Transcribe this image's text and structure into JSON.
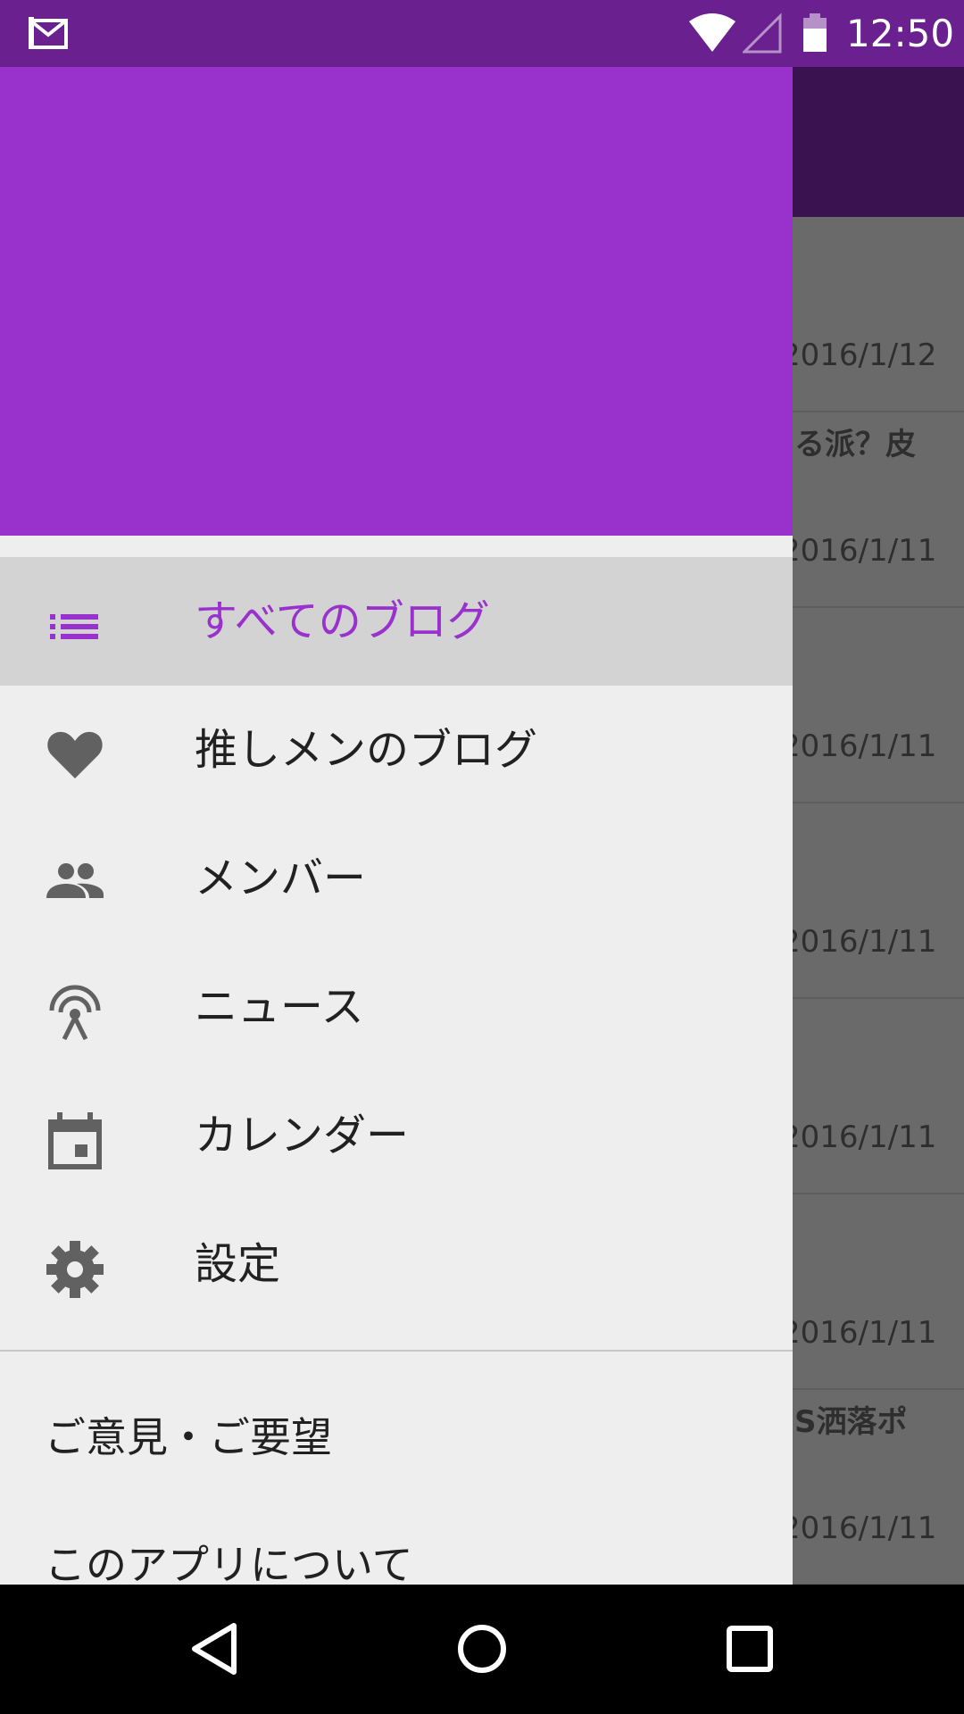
{
  "status_bar": {
    "time": "12:50"
  },
  "background_list": {
    "rows": [
      {
        "title": "",
        "date": "2016/1/12"
      },
      {
        "title": "る派？皮",
        "date": "2016/1/11"
      },
      {
        "title": "",
        "date": "2016/1/11"
      },
      {
        "title": "",
        "date": "2016/1/11"
      },
      {
        "title": "",
        "date": "2016/1/11"
      },
      {
        "title": "",
        "date": "2016/1/11"
      },
      {
        "title": "S洒落ポ",
        "date": "2016/1/11"
      }
    ]
  },
  "drawer": {
    "nav_items": [
      {
        "label": "すべてのブログ",
        "icon": "list-icon",
        "selected": true
      },
      {
        "label": "推しメンのブログ",
        "icon": "heart-icon",
        "selected": false
      },
      {
        "label": "メンバー",
        "icon": "people-icon",
        "selected": false
      },
      {
        "label": "ニュース",
        "icon": "broadcast-icon",
        "selected": false
      },
      {
        "label": "カレンダー",
        "icon": "calendar-icon",
        "selected": false
      },
      {
        "label": "設定",
        "icon": "gear-icon",
        "selected": false
      }
    ],
    "secondary_items": [
      {
        "label": "ご意見・ご要望"
      },
      {
        "label": "このアプリについて"
      }
    ]
  },
  "colors": {
    "accent": "#9932cc",
    "status_bar": "#6a218f",
    "icon_gray": "#616161"
  }
}
